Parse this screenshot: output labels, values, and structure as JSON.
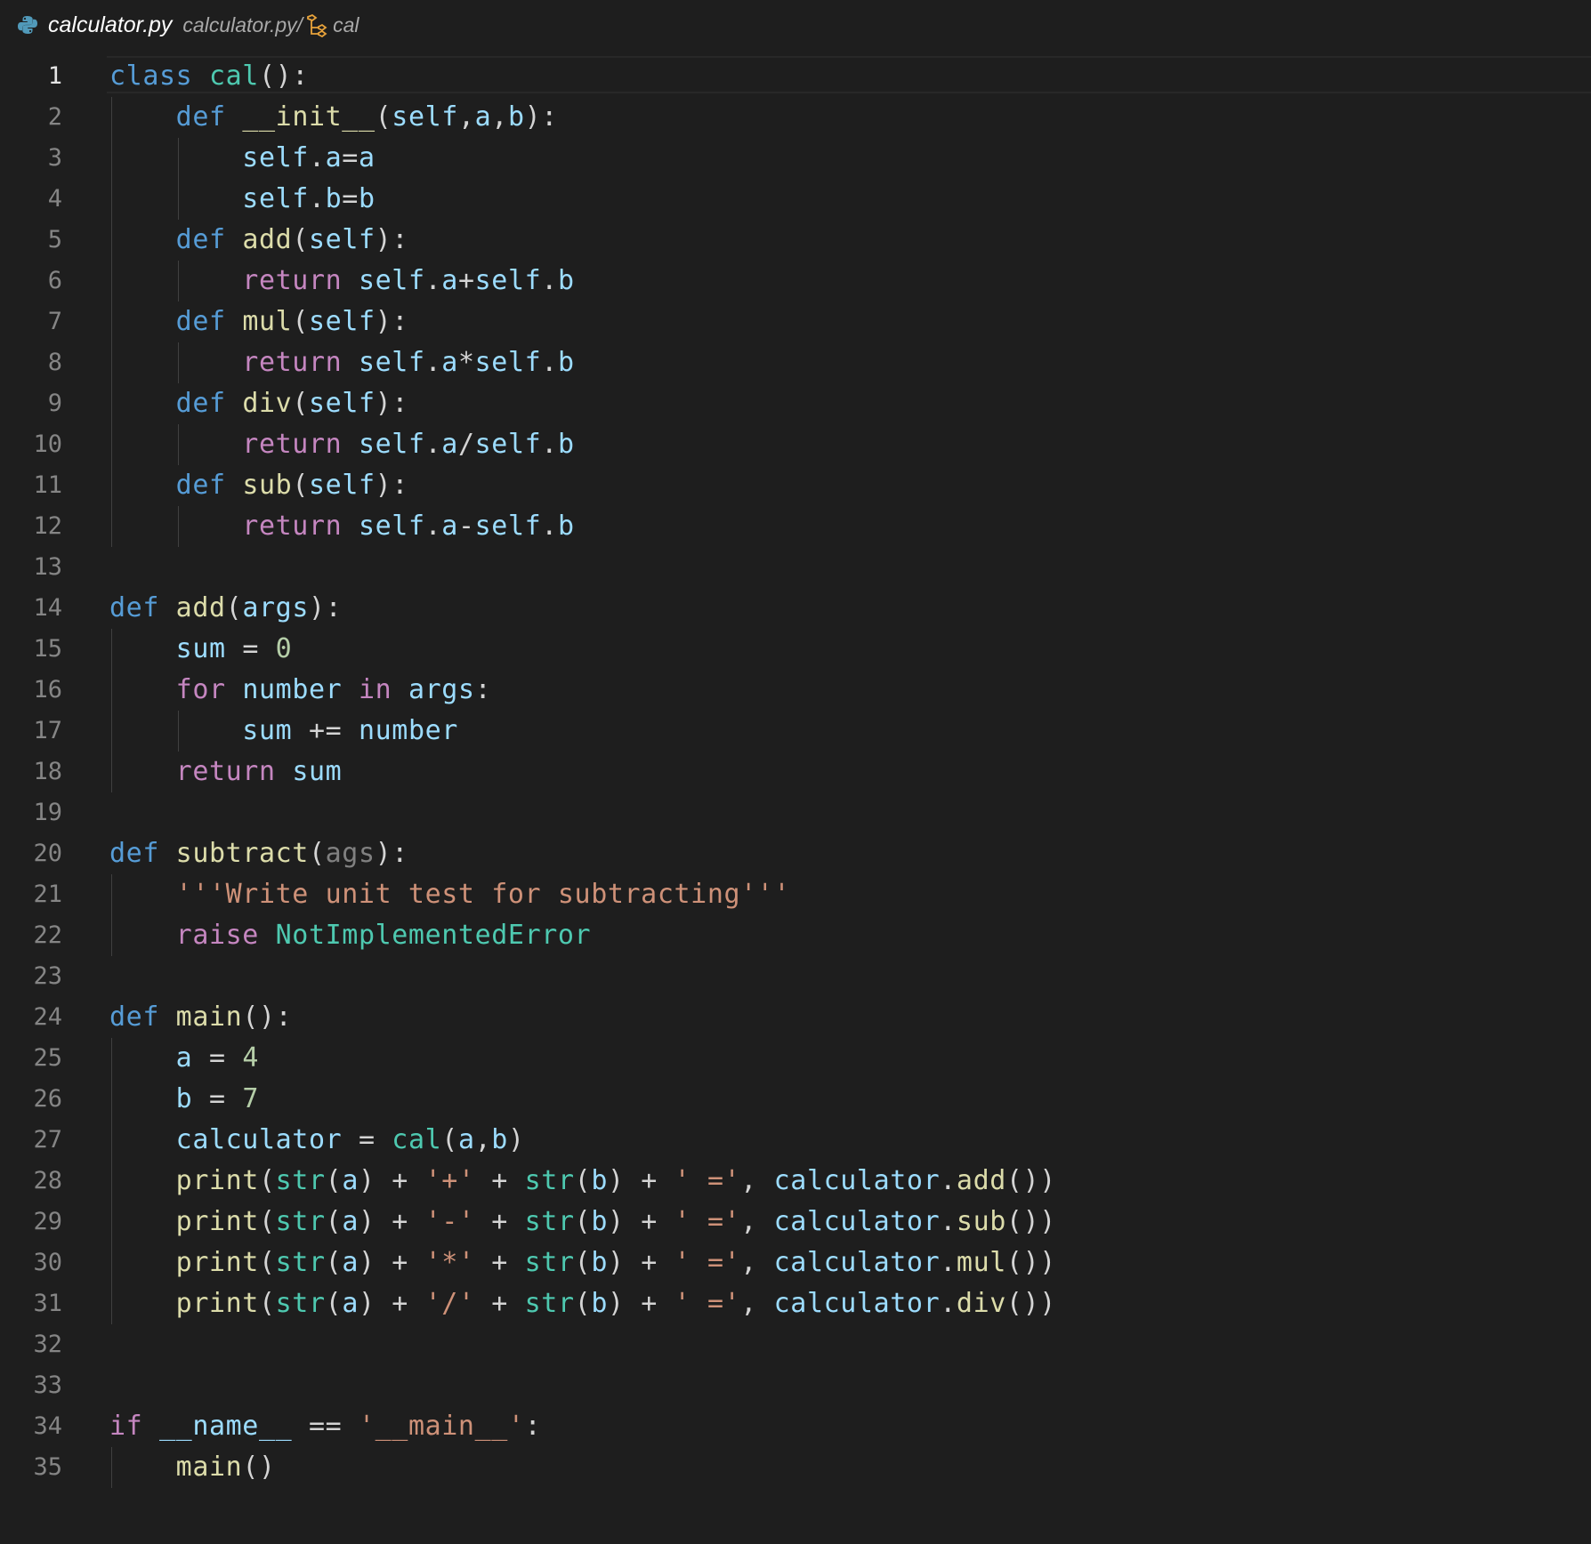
{
  "breadcrumb": {
    "file_name": "calculator.py",
    "path": "calculator.py/",
    "symbol": "cal"
  },
  "editor": {
    "active_line": 1,
    "lines": [
      {
        "n": "1",
        "tokens": [
          [
            "kw",
            "class"
          ],
          [
            "op",
            " "
          ],
          [
            "cls",
            "cal"
          ],
          [
            "op",
            "():"
          ]
        ]
      },
      {
        "n": "2",
        "tokens": [
          [
            "op",
            "    "
          ],
          [
            "kw",
            "def"
          ],
          [
            "op",
            " "
          ],
          [
            "fn",
            "__init__"
          ],
          [
            "op",
            "("
          ],
          [
            "var",
            "self"
          ],
          [
            "op",
            ","
          ],
          [
            "var",
            "a"
          ],
          [
            "op",
            ","
          ],
          [
            "var",
            "b"
          ],
          [
            "op",
            "):"
          ]
        ]
      },
      {
        "n": "3",
        "tokens": [
          [
            "op",
            "        "
          ],
          [
            "var",
            "self"
          ],
          [
            "op",
            "."
          ],
          [
            "var",
            "a"
          ],
          [
            "op",
            "="
          ],
          [
            "var",
            "a"
          ]
        ]
      },
      {
        "n": "4",
        "tokens": [
          [
            "op",
            "        "
          ],
          [
            "var",
            "self"
          ],
          [
            "op",
            "."
          ],
          [
            "var",
            "b"
          ],
          [
            "op",
            "="
          ],
          [
            "var",
            "b"
          ]
        ]
      },
      {
        "n": "5",
        "tokens": [
          [
            "op",
            "    "
          ],
          [
            "kw",
            "def"
          ],
          [
            "op",
            " "
          ],
          [
            "fn",
            "add"
          ],
          [
            "op",
            "("
          ],
          [
            "var",
            "self"
          ],
          [
            "op",
            "):"
          ]
        ]
      },
      {
        "n": "6",
        "tokens": [
          [
            "op",
            "        "
          ],
          [
            "ctl",
            "return"
          ],
          [
            "op",
            " "
          ],
          [
            "var",
            "self"
          ],
          [
            "op",
            "."
          ],
          [
            "var",
            "a"
          ],
          [
            "op",
            "+"
          ],
          [
            "var",
            "self"
          ],
          [
            "op",
            "."
          ],
          [
            "var",
            "b"
          ]
        ]
      },
      {
        "n": "7",
        "tokens": [
          [
            "op",
            "    "
          ],
          [
            "kw",
            "def"
          ],
          [
            "op",
            " "
          ],
          [
            "fn",
            "mul"
          ],
          [
            "op",
            "("
          ],
          [
            "var",
            "self"
          ],
          [
            "op",
            "):"
          ]
        ]
      },
      {
        "n": "8",
        "tokens": [
          [
            "op",
            "        "
          ],
          [
            "ctl",
            "return"
          ],
          [
            "op",
            " "
          ],
          [
            "var",
            "self"
          ],
          [
            "op",
            "."
          ],
          [
            "var",
            "a"
          ],
          [
            "op",
            "*"
          ],
          [
            "var",
            "self"
          ],
          [
            "op",
            "."
          ],
          [
            "var",
            "b"
          ]
        ]
      },
      {
        "n": "9",
        "tokens": [
          [
            "op",
            "    "
          ],
          [
            "kw",
            "def"
          ],
          [
            "op",
            " "
          ],
          [
            "fn",
            "div"
          ],
          [
            "op",
            "("
          ],
          [
            "var",
            "self"
          ],
          [
            "op",
            "):"
          ]
        ]
      },
      {
        "n": "10",
        "tokens": [
          [
            "op",
            "        "
          ],
          [
            "ctl",
            "return"
          ],
          [
            "op",
            " "
          ],
          [
            "var",
            "self"
          ],
          [
            "op",
            "."
          ],
          [
            "var",
            "a"
          ],
          [
            "op",
            "/"
          ],
          [
            "var",
            "self"
          ],
          [
            "op",
            "."
          ],
          [
            "var",
            "b"
          ]
        ]
      },
      {
        "n": "11",
        "tokens": [
          [
            "op",
            "    "
          ],
          [
            "kw",
            "def"
          ],
          [
            "op",
            " "
          ],
          [
            "fn",
            "sub"
          ],
          [
            "op",
            "("
          ],
          [
            "var",
            "self"
          ],
          [
            "op",
            "):"
          ]
        ]
      },
      {
        "n": "12",
        "tokens": [
          [
            "op",
            "        "
          ],
          [
            "ctl",
            "return"
          ],
          [
            "op",
            " "
          ],
          [
            "var",
            "self"
          ],
          [
            "op",
            "."
          ],
          [
            "var",
            "a"
          ],
          [
            "op",
            "-"
          ],
          [
            "var",
            "self"
          ],
          [
            "op",
            "."
          ],
          [
            "var",
            "b"
          ]
        ]
      },
      {
        "n": "13",
        "tokens": []
      },
      {
        "n": "14",
        "tokens": [
          [
            "kw",
            "def"
          ],
          [
            "op",
            " "
          ],
          [
            "fn",
            "add"
          ],
          [
            "op",
            "("
          ],
          [
            "var",
            "args"
          ],
          [
            "op",
            "):"
          ]
        ]
      },
      {
        "n": "15",
        "tokens": [
          [
            "op",
            "    "
          ],
          [
            "var",
            "sum"
          ],
          [
            "op",
            " = "
          ],
          [
            "num",
            "0"
          ]
        ]
      },
      {
        "n": "16",
        "tokens": [
          [
            "op",
            "    "
          ],
          [
            "ctl",
            "for"
          ],
          [
            "op",
            " "
          ],
          [
            "var",
            "number"
          ],
          [
            "op",
            " "
          ],
          [
            "ctl",
            "in"
          ],
          [
            "op",
            " "
          ],
          [
            "var",
            "args"
          ],
          [
            "op",
            ":"
          ]
        ]
      },
      {
        "n": "17",
        "tokens": [
          [
            "op",
            "        "
          ],
          [
            "var",
            "sum"
          ],
          [
            "op",
            " += "
          ],
          [
            "var",
            "number"
          ]
        ]
      },
      {
        "n": "18",
        "tokens": [
          [
            "op",
            "    "
          ],
          [
            "ctl",
            "return"
          ],
          [
            "op",
            " "
          ],
          [
            "var",
            "sum"
          ]
        ]
      },
      {
        "n": "19",
        "tokens": []
      },
      {
        "n": "20",
        "tokens": [
          [
            "kw",
            "def"
          ],
          [
            "op",
            " "
          ],
          [
            "fn",
            "subtract"
          ],
          [
            "op",
            "("
          ],
          [
            "dim",
            "ags"
          ],
          [
            "op",
            "):"
          ]
        ]
      },
      {
        "n": "21",
        "tokens": [
          [
            "op",
            "    "
          ],
          [
            "str",
            "'''Write unit test for subtracting'''"
          ]
        ]
      },
      {
        "n": "22",
        "tokens": [
          [
            "op",
            "    "
          ],
          [
            "ctl",
            "raise"
          ],
          [
            "op",
            " "
          ],
          [
            "cls",
            "NotImplementedError"
          ]
        ]
      },
      {
        "n": "23",
        "tokens": []
      },
      {
        "n": "24",
        "tokens": [
          [
            "kw",
            "def"
          ],
          [
            "op",
            " "
          ],
          [
            "fn",
            "main"
          ],
          [
            "op",
            "():"
          ]
        ]
      },
      {
        "n": "25",
        "tokens": [
          [
            "op",
            "    "
          ],
          [
            "var",
            "a"
          ],
          [
            "op",
            " = "
          ],
          [
            "num",
            "4"
          ]
        ]
      },
      {
        "n": "26",
        "tokens": [
          [
            "op",
            "    "
          ],
          [
            "var",
            "b"
          ],
          [
            "op",
            " = "
          ],
          [
            "num",
            "7"
          ]
        ]
      },
      {
        "n": "27",
        "tokens": [
          [
            "op",
            "    "
          ],
          [
            "var",
            "calculator"
          ],
          [
            "op",
            " = "
          ],
          [
            "cls",
            "cal"
          ],
          [
            "op",
            "("
          ],
          [
            "var",
            "a"
          ],
          [
            "op",
            ","
          ],
          [
            "var",
            "b"
          ],
          [
            "op",
            ")"
          ]
        ]
      },
      {
        "n": "28",
        "tokens": [
          [
            "op",
            "    "
          ],
          [
            "fn",
            "print"
          ],
          [
            "op",
            "("
          ],
          [
            "cls",
            "str"
          ],
          [
            "op",
            "("
          ],
          [
            "var",
            "a"
          ],
          [
            "op",
            ") + "
          ],
          [
            "str",
            "'+'"
          ],
          [
            "op",
            " + "
          ],
          [
            "cls",
            "str"
          ],
          [
            "op",
            "("
          ],
          [
            "var",
            "b"
          ],
          [
            "op",
            ") + "
          ],
          [
            "str",
            "' ='"
          ],
          [
            "op",
            ", "
          ],
          [
            "var",
            "calculator"
          ],
          [
            "op",
            "."
          ],
          [
            "fn",
            "add"
          ],
          [
            "op",
            "())"
          ]
        ]
      },
      {
        "n": "29",
        "tokens": [
          [
            "op",
            "    "
          ],
          [
            "fn",
            "print"
          ],
          [
            "op",
            "("
          ],
          [
            "cls",
            "str"
          ],
          [
            "op",
            "("
          ],
          [
            "var",
            "a"
          ],
          [
            "op",
            ") + "
          ],
          [
            "str",
            "'-'"
          ],
          [
            "op",
            " + "
          ],
          [
            "cls",
            "str"
          ],
          [
            "op",
            "("
          ],
          [
            "var",
            "b"
          ],
          [
            "op",
            ") + "
          ],
          [
            "str",
            "' ='"
          ],
          [
            "op",
            ", "
          ],
          [
            "var",
            "calculator"
          ],
          [
            "op",
            "."
          ],
          [
            "fn",
            "sub"
          ],
          [
            "op",
            "())"
          ]
        ]
      },
      {
        "n": "30",
        "tokens": [
          [
            "op",
            "    "
          ],
          [
            "fn",
            "print"
          ],
          [
            "op",
            "("
          ],
          [
            "cls",
            "str"
          ],
          [
            "op",
            "("
          ],
          [
            "var",
            "a"
          ],
          [
            "op",
            ") + "
          ],
          [
            "str",
            "'*'"
          ],
          [
            "op",
            " + "
          ],
          [
            "cls",
            "str"
          ],
          [
            "op",
            "("
          ],
          [
            "var",
            "b"
          ],
          [
            "op",
            ") + "
          ],
          [
            "str",
            "' ='"
          ],
          [
            "op",
            ", "
          ],
          [
            "var",
            "calculator"
          ],
          [
            "op",
            "."
          ],
          [
            "fn",
            "mul"
          ],
          [
            "op",
            "())"
          ]
        ]
      },
      {
        "n": "31",
        "tokens": [
          [
            "op",
            "    "
          ],
          [
            "fn",
            "print"
          ],
          [
            "op",
            "("
          ],
          [
            "cls",
            "str"
          ],
          [
            "op",
            "("
          ],
          [
            "var",
            "a"
          ],
          [
            "op",
            ") + "
          ],
          [
            "str",
            "'/'"
          ],
          [
            "op",
            " + "
          ],
          [
            "cls",
            "str"
          ],
          [
            "op",
            "("
          ],
          [
            "var",
            "b"
          ],
          [
            "op",
            ") + "
          ],
          [
            "str",
            "' ='"
          ],
          [
            "op",
            ", "
          ],
          [
            "var",
            "calculator"
          ],
          [
            "op",
            "."
          ],
          [
            "fn",
            "div"
          ],
          [
            "op",
            "())"
          ]
        ]
      },
      {
        "n": "32",
        "tokens": []
      },
      {
        "n": "33",
        "tokens": []
      },
      {
        "n": "34",
        "tokens": [
          [
            "ctl",
            "if"
          ],
          [
            "op",
            " "
          ],
          [
            "var",
            "__name__"
          ],
          [
            "op",
            " == "
          ],
          [
            "str",
            "'__main__'"
          ],
          [
            "op",
            ":"
          ]
        ]
      },
      {
        "n": "35",
        "tokens": [
          [
            "op",
            "    "
          ],
          [
            "fn",
            "main"
          ],
          [
            "op",
            "()"
          ]
        ]
      }
    ]
  },
  "colors": {
    "background": "#1e1e1e",
    "keyword": "#569cd6",
    "control": "#c586c0",
    "function": "#dcdcaa",
    "class": "#4ec9b0",
    "variable": "#9cdcfe",
    "string": "#ce9178",
    "number": "#b5cea8",
    "symbol_icon": "#e8a33b",
    "python_icon": "#519aba"
  },
  "icons": {
    "file": "python-file-icon",
    "symbol": "class-symbol-icon"
  }
}
